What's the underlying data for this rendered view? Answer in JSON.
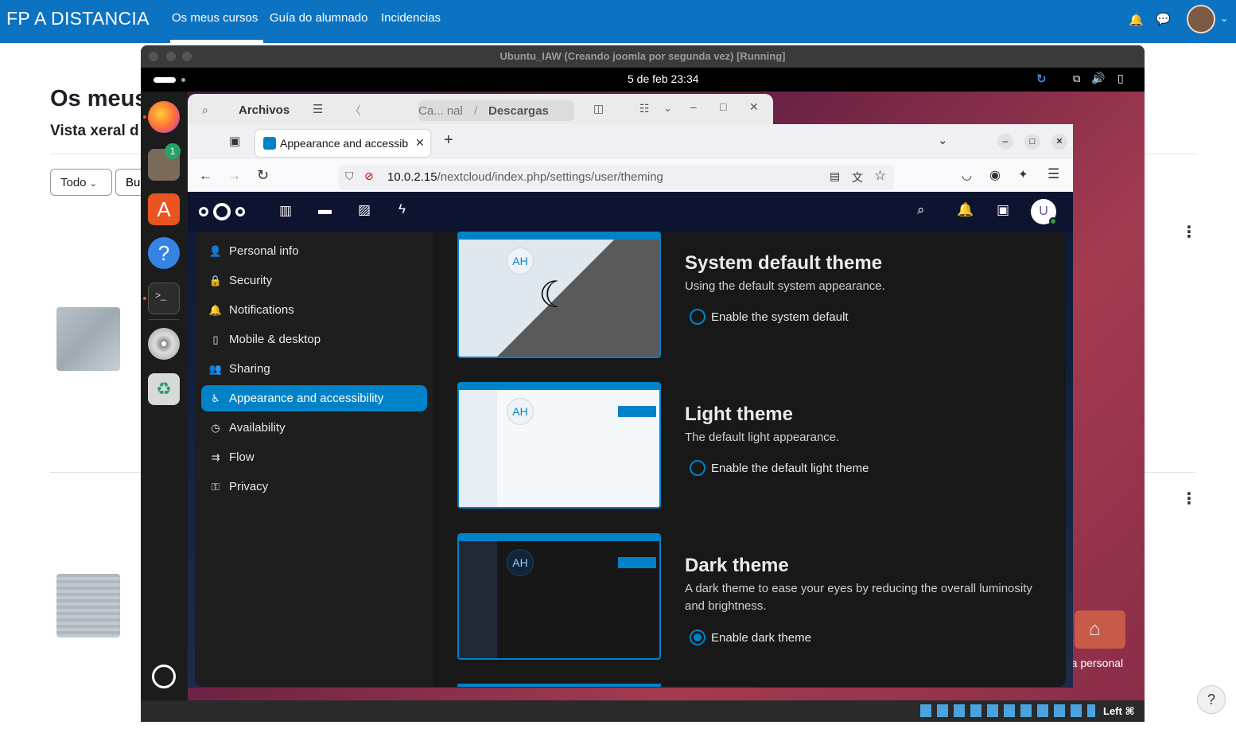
{
  "moodle": {
    "brand": "FP A DISTANCIA",
    "nav": [
      "Os meus cursos",
      "Guía do alumnado",
      "Incidencias"
    ],
    "title": "Os meus",
    "subtitle": "Vista xeral d",
    "filter_all": "Todo",
    "search_partial": "Bu",
    "help": "?",
    "home_folder": "eta personal"
  },
  "vm": {
    "title": "Ubuntu_IAW (Creando joomla por segunda vez) [Running]",
    "clock": "5 de feb  23:34",
    "status_key": "Left ⌘",
    "dock_badge": "1"
  },
  "files": {
    "title": "Archivos",
    "path_1": "Ca... nal",
    "path_sep": "/",
    "path_2": "Descargas"
  },
  "firefox": {
    "tab_title": "Appearance and accessib",
    "url_host": "10.0.2.15",
    "url_path": "/nextcloud/index.php/settings/user/theming",
    "avatar_letter": "U"
  },
  "sidebar": {
    "items": [
      {
        "label": "Personal info",
        "icon": "person-icon"
      },
      {
        "label": "Security",
        "icon": "lock-icon"
      },
      {
        "label": "Notifications",
        "icon": "bell-icon"
      },
      {
        "label": "Mobile & desktop",
        "icon": "phone-icon"
      },
      {
        "label": "Sharing",
        "icon": "share-icon"
      },
      {
        "label": "Appearance and accessibility",
        "icon": "accessibility-icon"
      },
      {
        "label": "Availability",
        "icon": "clock-icon"
      },
      {
        "label": "Flow",
        "icon": "flow-icon"
      },
      {
        "label": "Privacy",
        "icon": "key-icon"
      }
    ],
    "active_index": 5
  },
  "themes": [
    {
      "title": "System default theme",
      "desc": "Using the default system appearance.",
      "option": "Enable the system default",
      "checked": false,
      "preview_initials": "AH"
    },
    {
      "title": "Light theme",
      "desc": "The default light appearance.",
      "option": "Enable the default light theme",
      "checked": false,
      "preview_initials": "AH"
    },
    {
      "title": "Dark theme",
      "desc": "A dark theme to ease your eyes by reducing the overall luminosity and brightness.",
      "option": "Enable dark theme",
      "checked": true,
      "preview_initials": "AH"
    }
  ],
  "colors": {
    "moodle_blue": "#0b73c2",
    "nextcloud_primary": "#0082c9",
    "panel_dark": "#181818"
  }
}
